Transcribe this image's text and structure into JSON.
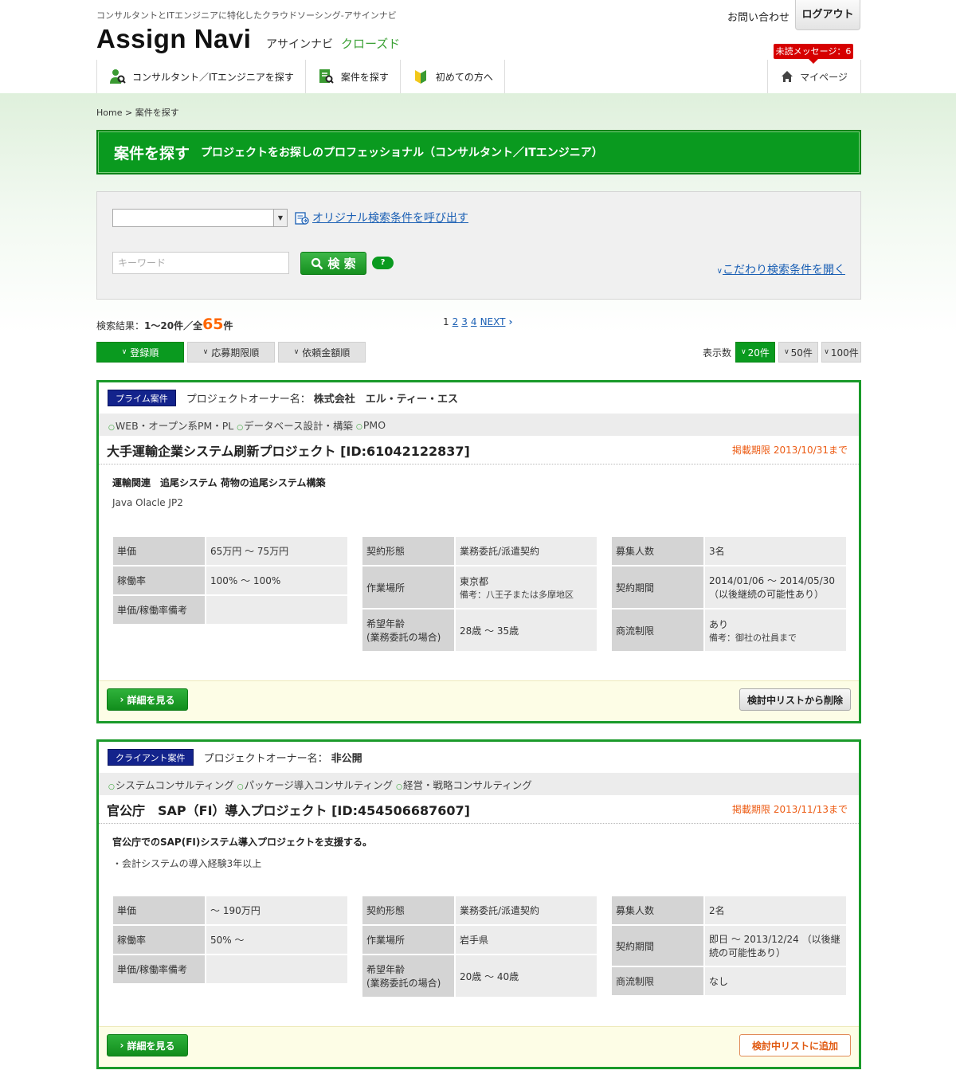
{
  "header": {
    "tagline": "コンサルタントとITエンジニアに特化したクラウドソーシング-アサインナビ",
    "logo_text": "Assign Navi",
    "logo_kana": "アサインナビ",
    "closed_label": "クローズド",
    "inquiry_label": "お問い合わせ",
    "logout_label": "ログアウト",
    "unread_label": "未読メッセージ：6",
    "nav": [
      {
        "label": "コンサルタント／ITエンジニアを探す",
        "icon": "person-search-icon"
      },
      {
        "label": "案件を探す",
        "icon": "document-search-icon"
      },
      {
        "label": "初めての方へ",
        "icon": "beginner-mark-icon"
      }
    ],
    "mypage_label": "マイページ"
  },
  "breadcrumb": "Home > 案件を探す",
  "page": {
    "title": "案件を探す",
    "subtitle": "プロジェクトをお探しのプロフェッショナル（コンサルタント／ITエンジニア）"
  },
  "search": {
    "saved_select_value": "",
    "call_link": "オリジナル検索条件を呼び出す",
    "keyword_placeholder": "キーワード",
    "search_button": "検 索",
    "help_label": "?",
    "advanced_link": "こだわり検索条件を開く"
  },
  "results": {
    "prefix": "検索結果：",
    "range": "1〜20件／全",
    "total": "65",
    "suffix": "件",
    "pages": [
      "1",
      "2",
      "3",
      "4"
    ],
    "next_label": "NEXT"
  },
  "sort": {
    "options": [
      "登録順",
      "応募期限順",
      "依頼金額順"
    ],
    "display_label": "表示数",
    "page_sizes": [
      "20件",
      "50件",
      "100件"
    ]
  },
  "projects": [
    {
      "badge": "プライム案件",
      "owner_label": "プロジェクトオーナー名：",
      "owner": "株式会社　エル・ティー・エス",
      "tags": [
        "WEB・オープン系PM・PL",
        "データベース設計・構築",
        "PMO"
      ],
      "title": "大手運輸企業システム刷新プロジェクト [ID:61042122837]",
      "deadline": "掲載期限 2013/10/31まで",
      "desc_main": "運輸関連　追尾システム 荷物の追尾システム構築",
      "desc_sub": "Java Olacle JP2",
      "t1": [
        {
          "k": "単価",
          "v": "65万円 〜 75万円",
          "note": ""
        },
        {
          "k": "稼働率",
          "v": "100% 〜 100%",
          "note": ""
        },
        {
          "k": "単価/稼働率備考",
          "v": "",
          "note": ""
        }
      ],
      "t2": [
        {
          "k": "契約形態",
          "v": "業務委託/派遣契約",
          "note": ""
        },
        {
          "k": "作業場所",
          "v": "東京都",
          "note": "備考：八王子または多摩地区"
        },
        {
          "k": "希望年齢\n(業務委託の場合)",
          "v": "28歳 〜 35歳",
          "note": ""
        }
      ],
      "t3": [
        {
          "k": "募集人数",
          "v": "3名",
          "note": ""
        },
        {
          "k": "契約期間",
          "v": "2014/01/06 〜 2014/05/30\n（以後継続の可能性あり）",
          "note": ""
        },
        {
          "k": "商流制限",
          "v": "あり",
          "note": "備考：御社の社員まで"
        }
      ],
      "detail_button": "詳細を見る",
      "list_button": "検討中リストから削除",
      "list_state": "remove"
    },
    {
      "badge": "クライアント案件",
      "owner_label": "プロジェクトオーナー名：",
      "owner": "非公開",
      "tags": [
        "システムコンサルティング",
        "パッケージ導入コンサルティング",
        "経営・戦略コンサルティング"
      ],
      "title": "官公庁　SAP（FI）導入プロジェクト [ID:454506687607]",
      "deadline": "掲載期限 2013/11/13まで",
      "desc_main": "官公庁でのSAP(FI)システム導入プロジェクトを支援する。",
      "desc_sub": "・会計システムの導入経験3年以上",
      "t1": [
        {
          "k": "単価",
          "v": "〜 190万円",
          "note": ""
        },
        {
          "k": "稼働率",
          "v": "50% 〜",
          "note": ""
        },
        {
          "k": "単価/稼働率備考",
          "v": "",
          "note": ""
        }
      ],
      "t2": [
        {
          "k": "契約形態",
          "v": "業務委託/派遣契約",
          "note": ""
        },
        {
          "k": "作業場所",
          "v": "岩手県",
          "note": ""
        },
        {
          "k": "希望年齢\n(業務委託の場合)",
          "v": "20歳 〜 40歳",
          "note": ""
        }
      ],
      "t3": [
        {
          "k": "募集人数",
          "v": "2名",
          "note": ""
        },
        {
          "k": "契約期間",
          "v": "即日 〜 2013/12/24 （以後継続の可能性あり）",
          "note": ""
        },
        {
          "k": "商流制限",
          "v": "なし",
          "note": ""
        }
      ],
      "detail_button": "詳細を見る",
      "list_button": "検討中リストに追加",
      "list_state": "add"
    }
  ],
  "colors": {
    "accent_green": "#0a9a1f",
    "badge_navy": "#13238c",
    "deadline_orange": "#ec5a12",
    "alert_red": "#d60000"
  }
}
